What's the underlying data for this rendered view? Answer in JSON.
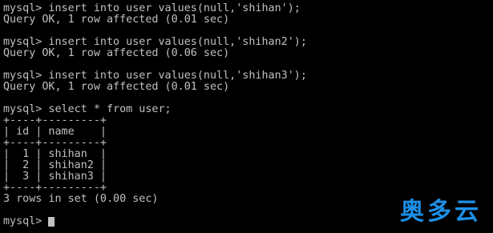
{
  "terminal": {
    "blocks": {
      "b1": {
        "cmd": "mysql> insert into user values(null,'shihan');",
        "out": "Query OK, 1 row affected (0.01 sec)"
      },
      "b2": {
        "cmd": "mysql> insert into user values(null,'shihan2');",
        "out": "Query OK, 1 row affected (0.06 sec)"
      },
      "b3": {
        "cmd": "mysql> insert into user values(null,'shihan3');",
        "out": "Query OK, 1 row affected (0.01 sec)"
      },
      "b4": {
        "cmd": "mysql> select * from user;"
      }
    },
    "result_table": {
      "border": "+----+---------+",
      "header": "| id | name    |",
      "rows": [
        "|  1 | shihan  |",
        "|  2 | shihan2 |",
        "|  3 | shihan3 |"
      ]
    },
    "summary": "3 rows in set (0.00 sec)",
    "prompt": "mysql>"
  },
  "watermark": {
    "text": "奥多云"
  },
  "colors": {
    "background": "#000000",
    "text": "#c0c0c0",
    "watermark": "#1e90e8"
  }
}
